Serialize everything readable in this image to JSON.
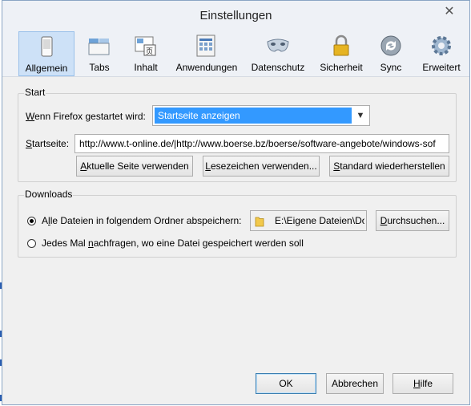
{
  "window": {
    "title": "Einstellungen",
    "close_glyph": "✕"
  },
  "toolbar": {
    "items": [
      {
        "label": "Allgemein",
        "icon": "switch-icon",
        "selected": true
      },
      {
        "label": "Tabs",
        "icon": "tabs-icon",
        "selected": false
      },
      {
        "label": "Inhalt",
        "icon": "content-icon",
        "selected": false
      },
      {
        "label": "Anwendungen",
        "icon": "applications-icon",
        "selected": false
      },
      {
        "label": "Datenschutz",
        "icon": "mask-icon",
        "selected": false
      },
      {
        "label": "Sicherheit",
        "icon": "lock-icon",
        "selected": false
      },
      {
        "label": "Sync",
        "icon": "sync-icon",
        "selected": false
      },
      {
        "label": "Erweitert",
        "icon": "gear-icon",
        "selected": false
      }
    ]
  },
  "start": {
    "group_title": "Start",
    "startup_label": "Wenn Firefox gestartet wird:",
    "startup_value": "Startseite anzeigen",
    "homepage_label": "Startseite:",
    "homepage_value": "http://www.t-online.de/|http://www.boerse.bz/boerse/software-angebote/windows-sof",
    "buttons": {
      "current_page": "Aktuelle Seite verwenden",
      "bookmark": "Lesezeichen verwenden...",
      "restore_default": "Standard wiederherstellen"
    }
  },
  "downloads": {
    "group_title": "Downloads",
    "save_to_label": "Alle Dateien in folgendem Ordner abspeichern:",
    "folder_path": "E:\\Eigene Dateien\\Do",
    "browse_button": "Durchsuchen...",
    "ask_label": "Jedes Mal nachfragen, wo eine Datei gespeichert werden soll",
    "save_to_selected": true
  },
  "footer": {
    "ok": "OK",
    "cancel": "Abbrechen",
    "help": "Hilfe"
  },
  "colors": {
    "selection": "#3399ff",
    "selected_tab_bg": "#cde1f7",
    "dialog_bg": "#f0f0f0"
  }
}
